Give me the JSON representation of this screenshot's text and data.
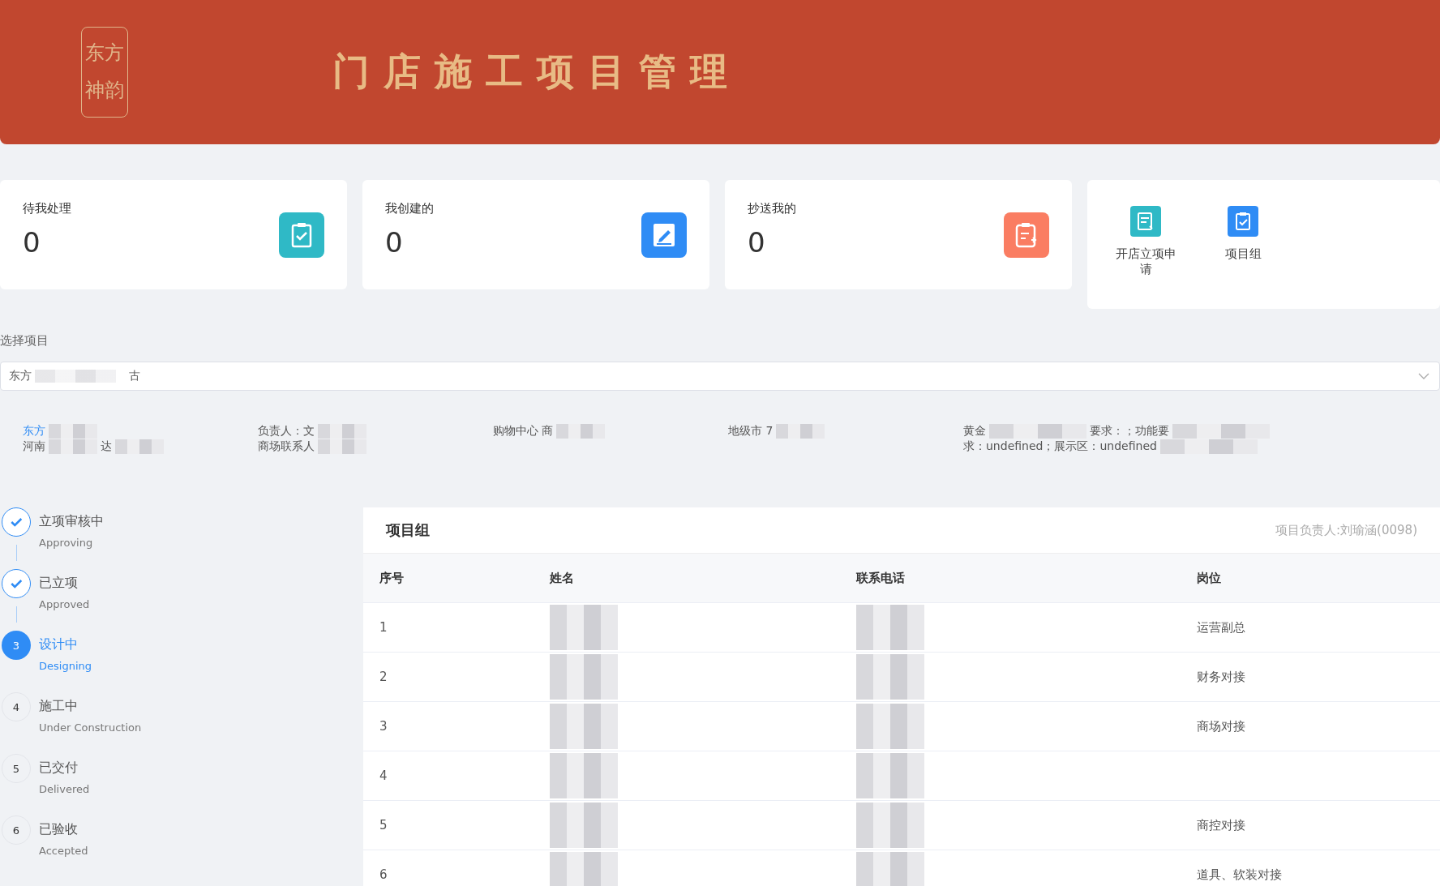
{
  "header": {
    "logo": [
      "东方",
      "神韵"
    ],
    "title": "门店施工项目管理"
  },
  "stat_cards": [
    {
      "label": "待我处理",
      "count": "0",
      "kind": "todo",
      "color": "#2fb9c6"
    },
    {
      "label": "我创建的",
      "count": "0",
      "kind": "created",
      "color": "#2f8cf5"
    },
    {
      "label": "抄送我的",
      "count": "0",
      "kind": "cc",
      "color": "#fa7d62"
    }
  ],
  "shortcuts": [
    {
      "label": "开店立项申请",
      "kind": "apply",
      "color": "#2fb9c6"
    },
    {
      "label": "项目组",
      "kind": "team",
      "color": "#2f8cf5"
    }
  ],
  "project_select": {
    "label": "选择项目",
    "value_parts": [
      "东方",
      "古"
    ]
  },
  "project_info": [
    {
      "lines": [
        [
          "东方"
        ],
        [
          "河南",
          "达"
        ]
      ],
      "link": true
    },
    {
      "lines": [
        [
          "负责人：文"
        ],
        [
          "商场联系人"
        ]
      ],
      "link": false
    },
    {
      "lines": [
        [
          "购物中心 商"
        ]
      ],
      "link": false
    },
    {
      "lines": [
        [
          "地级市 7"
        ]
      ],
      "link": false
    },
    {
      "lines": [
        [
          "黄金",
          "要求：；功能要"
        ],
        [
          "求：undefined；展示区：undefined"
        ]
      ],
      "link": false
    }
  ],
  "steps": [
    {
      "title": "立项审核中",
      "subtitle": "Approving",
      "done": true,
      "selected": false
    },
    {
      "title": "已立项",
      "subtitle": "Approved",
      "done": true,
      "selected": false
    },
    {
      "title": "设计中",
      "subtitle": "Designing",
      "number": "3",
      "done": false,
      "selected": true
    },
    {
      "title": "施工中",
      "subtitle": "Under Construction",
      "number": "4",
      "done": false,
      "selected": false
    },
    {
      "title": "已交付",
      "subtitle": "Delivered",
      "number": "5",
      "done": false,
      "selected": false
    },
    {
      "title": "已验收",
      "subtitle": "Accepted",
      "number": "6",
      "done": false,
      "selected": false
    }
  ],
  "team_panel": {
    "title": "项目组",
    "manager": "项目负责人:刘瑜涵(0098)",
    "columns": [
      "序号",
      "姓名",
      "联系电话",
      "岗位"
    ],
    "rows": [
      {
        "index": "1",
        "role": "运营副总"
      },
      {
        "index": "2",
        "role": "财务对接"
      },
      {
        "index": "3",
        "role": "商场对接"
      },
      {
        "index": "4"
      },
      {
        "index": "5",
        "role": "商控对接"
      },
      {
        "index": "6",
        "role": "道具、软装对接"
      }
    ]
  }
}
